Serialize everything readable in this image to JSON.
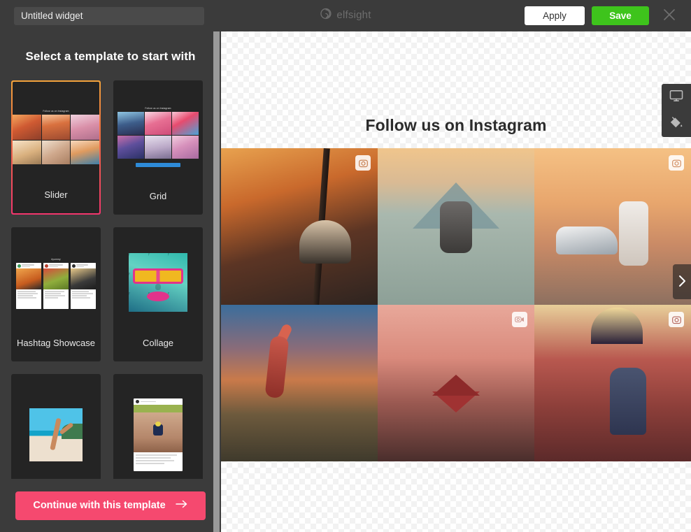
{
  "topbar": {
    "widget_name_value": "Untitled widget",
    "widget_name_placeholder": "Untitled widget",
    "brand_name": "elfsight",
    "brand_logo_icon": "elfsight-swirl-icon",
    "apply_label": "Apply",
    "save_label": "Save",
    "close_icon": "close-icon",
    "save_color": "#3ec41c",
    "apply_color": "#ffffff"
  },
  "sidebar": {
    "title": "Select a template to start with",
    "continue_label": "Continue with this template",
    "continue_arrow_icon": "arrow-right-icon",
    "continue_color": "#f5496f",
    "selected_template": "Slider",
    "templates": [
      {
        "label": "Slider",
        "mini_title": "Follow us on Instagram",
        "selected": true
      },
      {
        "label": "Grid",
        "mini_title": "Follow us on Instagram",
        "selected": false
      },
      {
        "label": "Hashtag Showcase",
        "mini_title": "#yummy",
        "selected": false
      },
      {
        "label": "Collage",
        "mini_title": "",
        "selected": false
      },
      {
        "label": "",
        "mini_title": "",
        "selected": false
      },
      {
        "label": "",
        "mini_title": "",
        "selected": false
      }
    ]
  },
  "preview": {
    "title": "Follow us on Instagram",
    "next_arrow_icon": "chevron-right-icon",
    "device_buttons": [
      {
        "icon": "desktop-monitor-icon"
      },
      {
        "icon": "paint-bucket-icon"
      }
    ],
    "photos": [
      {
        "badge": "camera-icon",
        "has_badge": true
      },
      {
        "badge": "",
        "has_badge": false
      },
      {
        "badge": "camera-icon",
        "has_badge": true
      },
      {
        "badge": "",
        "has_badge": false
      },
      {
        "badge": "video-camera-icon",
        "has_badge": true
      },
      {
        "badge": "camera-icon",
        "has_badge": true
      }
    ]
  }
}
